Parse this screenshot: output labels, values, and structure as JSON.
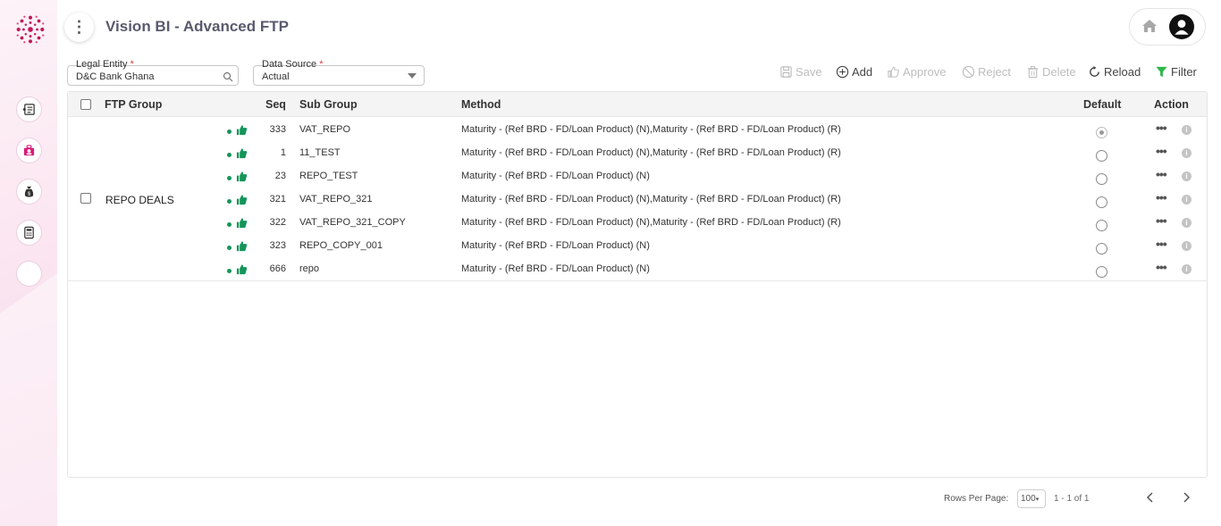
{
  "app": {
    "title": "Vision BI - Advanced FTP"
  },
  "sidebar": {
    "items": [
      {
        "icon": "document-list-icon"
      },
      {
        "icon": "user-group-icon"
      },
      {
        "icon": "money-bag-icon"
      },
      {
        "icon": "calculator-icon"
      },
      {
        "icon": "blank-icon"
      }
    ]
  },
  "filters": {
    "legal_entity": {
      "label": "Legal Entity",
      "required_mark": "*",
      "value": "D&C Bank Ghana"
    },
    "data_source": {
      "label": "Data Source",
      "required_mark": "*",
      "value": "Actual"
    }
  },
  "toolbar": {
    "save": "Save",
    "add": "Add",
    "approve": "Approve",
    "reject": "Reject",
    "delete": "Delete",
    "reload": "Reload",
    "filter": "Filter"
  },
  "table": {
    "headers": {
      "ftp_group": "FTP Group",
      "seq": "Seq",
      "sub_group": "Sub Group",
      "method": "Method",
      "default": "Default",
      "action": "Action"
    },
    "group_name": "REPO DEALS",
    "rows": [
      {
        "seq": "333",
        "sub_group": "VAT_REPO",
        "method": "Maturity - (Ref BRD - FD/Loan Product) (N),Maturity - (Ref BRD - FD/Loan Product) (R)",
        "default": true
      },
      {
        "seq": "1",
        "sub_group": "11_TEST",
        "method": "Maturity - (Ref BRD - FD/Loan Product) (N),Maturity - (Ref BRD - FD/Loan Product) (R)",
        "default": false
      },
      {
        "seq": "23",
        "sub_group": "REPO_TEST",
        "method": "Maturity - (Ref BRD - FD/Loan Product) (N)",
        "default": false
      },
      {
        "seq": "321",
        "sub_group": "VAT_REPO_321",
        "method": "Maturity - (Ref BRD - FD/Loan Product) (N),Maturity - (Ref BRD - FD/Loan Product) (R)",
        "default": false
      },
      {
        "seq": "322",
        "sub_group": "VAT_REPO_321_COPY",
        "method": "Maturity - (Ref BRD - FD/Loan Product) (N),Maturity - (Ref BRD - FD/Loan Product) (R)",
        "default": false
      },
      {
        "seq": "323",
        "sub_group": "REPO_COPY_001",
        "method": "Maturity - (Ref BRD - FD/Loan Product) (N)",
        "default": false
      },
      {
        "seq": "666",
        "sub_group": "repo",
        "method": "Maturity - (Ref BRD - FD/Loan Product) (N)",
        "default": false
      }
    ]
  },
  "pagination": {
    "rows_per_page_label": "Rows Per Page:",
    "rows_per_page": "100",
    "range": "1 - 1 of 1"
  },
  "colors": {
    "accent": "#d81b7a",
    "approved": "#14955a",
    "filter": "#2db84a"
  }
}
